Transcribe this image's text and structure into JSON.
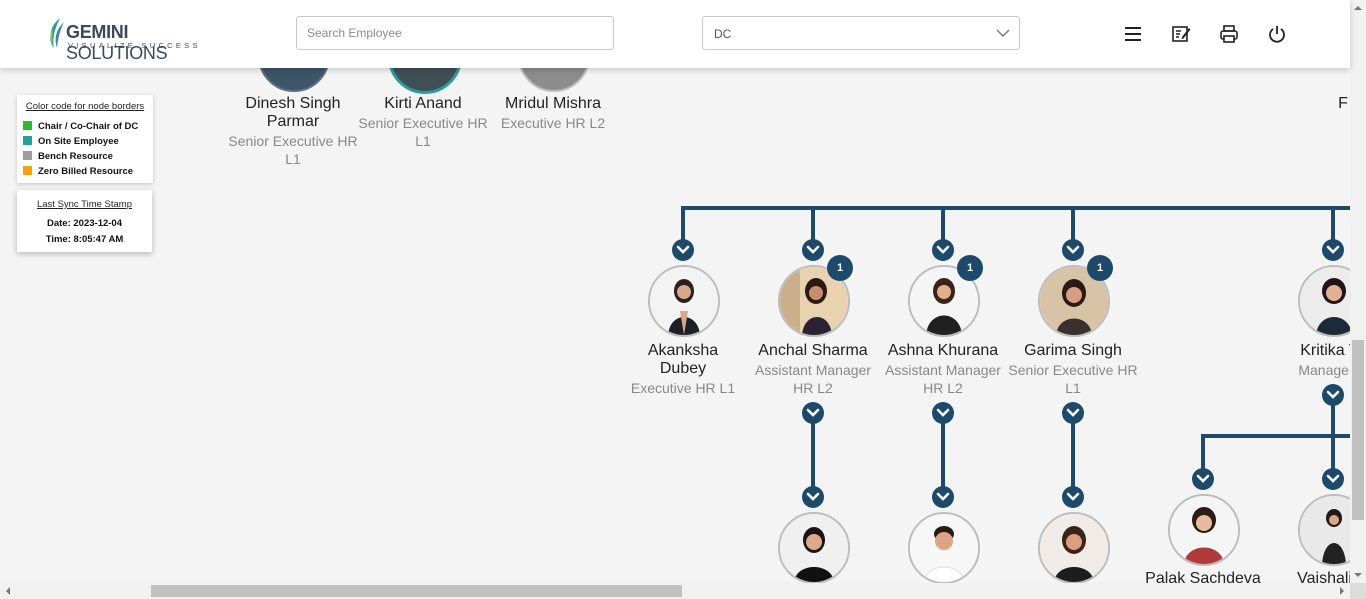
{
  "header": {
    "logo_word_1": "GEMINI",
    "logo_word_2": "SOLUTIONS",
    "logo_tagline": "VISUALIZE SUCCESS",
    "search_placeholder": "Search Employee",
    "filter_value": "DC",
    "icons": [
      "menu-icon",
      "edit-note-icon",
      "print-icon",
      "power-icon"
    ]
  },
  "legend": {
    "title": "Color code for node borders",
    "items": [
      {
        "label": "Chair / Co-Chair of DC",
        "color": "#2eb82e"
      },
      {
        "label": "On Site Employee",
        "color": "#2b9c9c"
      },
      {
        "label": "Bench Resource",
        "color": "#9e9e9e"
      },
      {
        "label": "Zero Billed Resource",
        "color": "#f0a30a"
      }
    ]
  },
  "sync": {
    "title": "Last Sync Time Stamp",
    "date": "Date: 2023-12-04",
    "time": "Time: 8:05:47 AM"
  },
  "top_nodes": [
    {
      "name": "Dinesh Singh Parmar",
      "role": "Senior Executive HR L1"
    },
    {
      "name": "Kirti Anand",
      "role": "Senior Executive HR L1"
    },
    {
      "name": "Mridul Mishra",
      "role": "Executive HR L2"
    },
    {
      "name": "F",
      "role": ""
    }
  ],
  "mid_nodes": [
    {
      "name": "Akanksha Dubey",
      "role": "Executive HR L1",
      "badge": ""
    },
    {
      "name": "Anchal Sharma",
      "role": "Assistant Manager HR L2",
      "badge": "1"
    },
    {
      "name": "Ashna Khurana",
      "role": "Assistant Manager HR L2",
      "badge": "1"
    },
    {
      "name": "Garima Singh",
      "role": "Senior Executive HR L1",
      "badge": "1"
    },
    {
      "name": "Kritika Ta",
      "role": "Manager H",
      "badge": ""
    }
  ],
  "bottom_nodes": [
    {
      "name": ""
    },
    {
      "name": ""
    },
    {
      "name": ""
    },
    {
      "name": "Palak Sachdeva"
    },
    {
      "name": "Vaishali G"
    }
  ],
  "colors": {
    "line": "#1d4a6b",
    "accent": "#2a9d8f"
  }
}
